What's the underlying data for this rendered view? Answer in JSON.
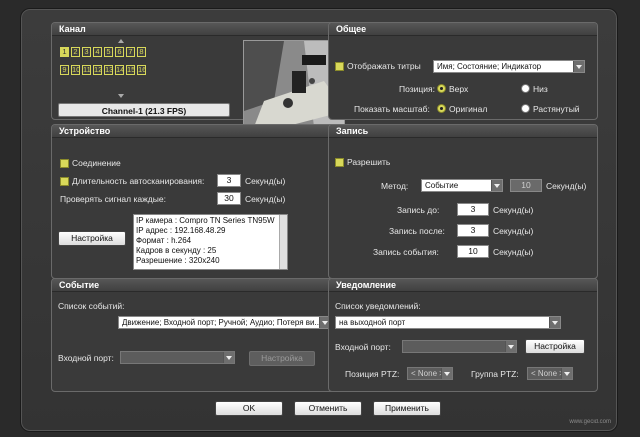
{
  "channel": {
    "title": "Канал",
    "row1": [
      "1",
      "2",
      "3",
      "4",
      "5",
      "6",
      "7",
      "8"
    ],
    "row2": [
      "9",
      "10",
      "11",
      "12",
      "13",
      "14",
      "15",
      "16"
    ],
    "selected": "1",
    "label": "Channel-1 (21.3 FPS)"
  },
  "general": {
    "title": "Общее",
    "show_titles_label": "Отображать титры",
    "titles_value": "Имя; Состояние; Индикатор",
    "position_label": "Позиция:",
    "position_top": "Верх",
    "position_bottom": "Низ",
    "scale_label": "Показать масштаб:",
    "scale_original": "Оригинал",
    "scale_stretched": "Растянутый"
  },
  "device": {
    "title": "Устройство",
    "connection_label": "Соединение",
    "autoscan_label": "Длительность автосканирования:",
    "autoscan_value": "3",
    "autoscan_unit": "Секунд(ы)",
    "check_label": "Проверять сигнал каждые:",
    "check_value": "30",
    "check_unit": "Секунд(ы)",
    "settings_button": "Настройка",
    "info": [
      "IP камера : Compro TN Series TN95W",
      "IP адрес : 192.168.48.29",
      "Формат : h.264",
      "Кадров в секунду : 25",
      "Разрешение : 320x240"
    ]
  },
  "record": {
    "title": "Запись",
    "allow_label": "Разрешить",
    "method_label": "Метод:",
    "method_value": "Событие",
    "method_seconds_value": "10",
    "method_unit": "Секунд(ы)",
    "before_label": "Запись до:",
    "before_value": "3",
    "before_unit": "Секунд(ы)",
    "after_label": "Запись после:",
    "after_value": "3",
    "after_unit": "Секунд(ы)",
    "event_label": "Запись события:",
    "event_value": "10",
    "event_unit": "Секунд(ы)"
  },
  "event": {
    "title": "Событие",
    "list_label": "Список событий:",
    "list_value": "Движение; Входной порт; Ручной; Аудио; Потеря ви...",
    "input_port_label": "Входной порт:",
    "input_port_value": "",
    "settings_button": "Настройка"
  },
  "notification": {
    "title": "Уведомление",
    "list_label": "Список уведомлений:",
    "list_value": "на выходной порт",
    "input_port_label": "Входной порт:",
    "input_port_value": "",
    "settings_button": "Настройка",
    "ptz_position_label": "Позиция PTZ:",
    "ptz_position_value": "< None >",
    "ptz_group_label": "Группа PTZ:",
    "ptz_group_value": "< None >"
  },
  "footer": {
    "ok": "OK",
    "cancel": "Отменить",
    "apply": "Применить"
  },
  "watermark": "www.gecid.com"
}
